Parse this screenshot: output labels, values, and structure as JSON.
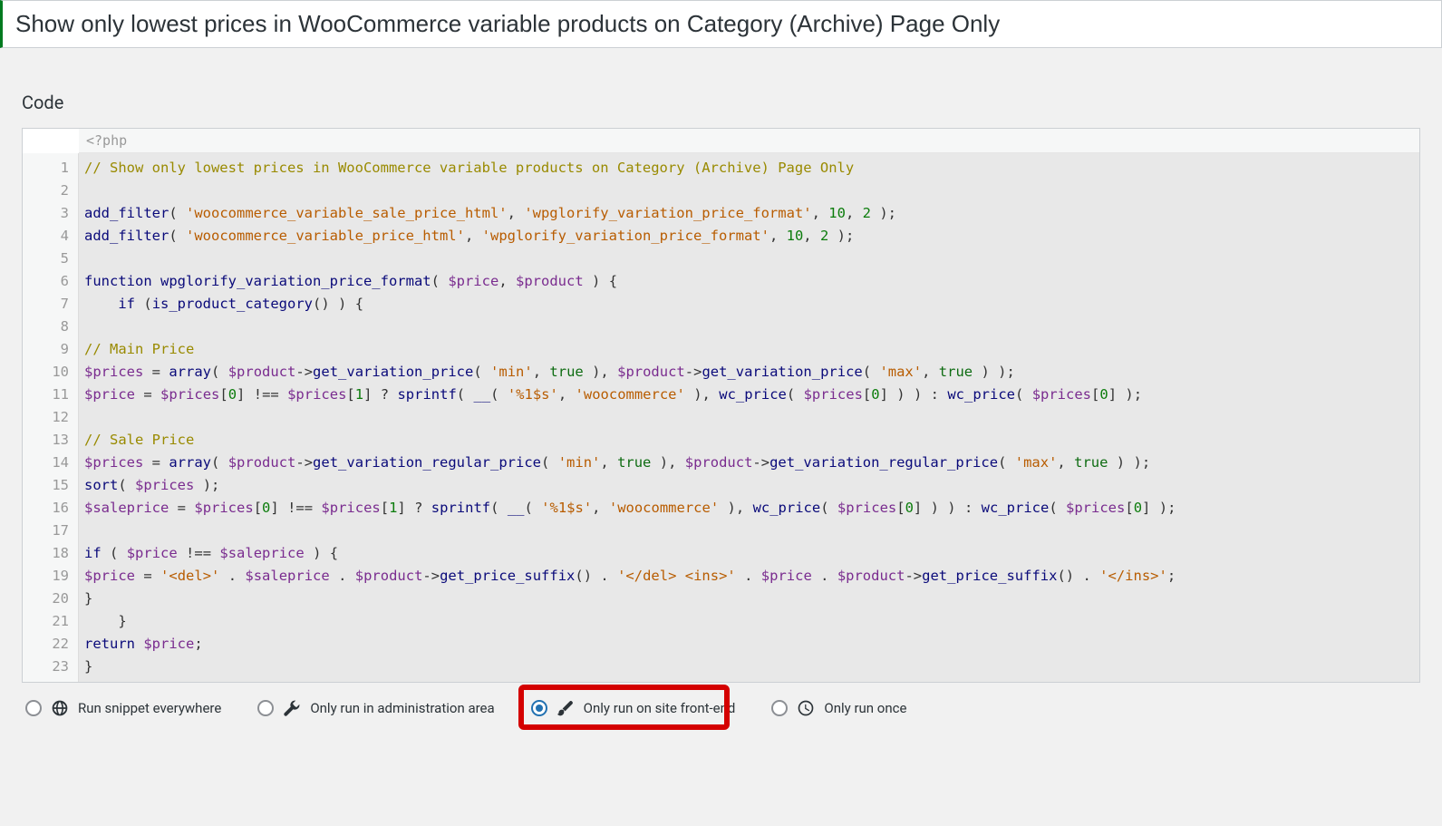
{
  "title": "Show only lowest prices in WooCommerce variable products on Category (Archive) Page Only",
  "section_heading": "Code",
  "php_opener": "<?php",
  "code": {
    "line_count": 23,
    "lines_html": [
      "<span class='c-comment'>// Show only lowest prices in WooCommerce variable products on Category (Archive) Page Only</span>",
      "",
      "<span class='c-fn'>add_filter</span><span class='c-paren'>(</span> <span class='c-str'>'woocommerce_variable_sale_price_html'</span><span class='c-plain'>,</span> <span class='c-str'>'wpglorify_variation_price_format'</span><span class='c-plain'>,</span> <span class='c-num'>10</span><span class='c-plain'>,</span> <span class='c-num'>2</span> <span class='c-paren'>)</span><span class='c-plain'>;</span>",
      "<span class='c-fn'>add_filter</span><span class='c-paren'>(</span> <span class='c-str'>'woocommerce_variable_price_html'</span><span class='c-plain'>,</span> <span class='c-str'>'wpglorify_variation_price_format'</span><span class='c-plain'>,</span> <span class='c-num'>10</span><span class='c-plain'>,</span> <span class='c-num'>2</span> <span class='c-paren'>)</span><span class='c-plain'>;</span>",
      "",
      "<span class='c-kw'>function</span> <span class='c-fn'>wpglorify_variation_price_format</span><span class='c-paren'>(</span> <span class='c-var'>$price</span><span class='c-plain'>,</span> <span class='c-var'>$product</span> <span class='c-paren'>)</span> <span class='c-paren'>{</span>",
      "    <span class='c-kw'>if</span> <span class='c-paren'>(</span><span class='c-fn'>is_product_category</span><span class='c-paren'>()</span> <span class='c-paren'>)</span> <span class='c-paren'>{</span>",
      "",
      "<span class='c-comment'>// Main Price</span>",
      "<span class='c-var'>$prices</span> <span class='c-op'>=</span> <span class='c-fn'>array</span><span class='c-paren'>(</span> <span class='c-var'>$product</span><span class='c-op'>-></span><span class='c-fn'>get_variation_price</span><span class='c-paren'>(</span> <span class='c-str'>'min'</span><span class='c-plain'>,</span> <span class='c-bool'>true</span> <span class='c-paren'>)</span><span class='c-plain'>,</span> <span class='c-var'>$product</span><span class='c-op'>-></span><span class='c-fn'>get_variation_price</span><span class='c-paren'>(</span> <span class='c-str'>'max'</span><span class='c-plain'>,</span> <span class='c-bool'>true</span> <span class='c-paren'>)</span> <span class='c-paren'>)</span><span class='c-plain'>;</span>",
      "<span class='c-var'>$price</span> <span class='c-op'>=</span> <span class='c-var'>$prices</span><span class='c-paren'>[</span><span class='c-num'>0</span><span class='c-paren'>]</span> <span class='c-op'>!==</span> <span class='c-var'>$prices</span><span class='c-paren'>[</span><span class='c-num'>1</span><span class='c-paren'>]</span> <span class='c-op'>?</span> <span class='c-fn'>sprintf</span><span class='c-paren'>(</span> <span class='c-fn'>__</span><span class='c-paren'>(</span> <span class='c-str'>'%1$s'</span><span class='c-plain'>,</span> <span class='c-str'>'woocommerce'</span> <span class='c-paren'>)</span><span class='c-plain'>,</span> <span class='c-fn'>wc_price</span><span class='c-paren'>(</span> <span class='c-var'>$prices</span><span class='c-paren'>[</span><span class='c-num'>0</span><span class='c-paren'>]</span> <span class='c-paren'>)</span> <span class='c-paren'>)</span> <span class='c-op'>:</span> <span class='c-fn'>wc_price</span><span class='c-paren'>(</span> <span class='c-var'>$prices</span><span class='c-paren'>[</span><span class='c-num'>0</span><span class='c-paren'>]</span> <span class='c-paren'>)</span><span class='c-plain'>;</span>",
      "",
      "<span class='c-comment'>// Sale Price</span>",
      "<span class='c-var'>$prices</span> <span class='c-op'>=</span> <span class='c-fn'>array</span><span class='c-paren'>(</span> <span class='c-var'>$product</span><span class='c-op'>-></span><span class='c-fn'>get_variation_regular_price</span><span class='c-paren'>(</span> <span class='c-str'>'min'</span><span class='c-plain'>,</span> <span class='c-bool'>true</span> <span class='c-paren'>)</span><span class='c-plain'>,</span> <span class='c-var'>$product</span><span class='c-op'>-></span><span class='c-fn'>get_variation_regular_price</span><span class='c-paren'>(</span> <span class='c-str'>'max'</span><span class='c-plain'>,</span> <span class='c-bool'>true</span> <span class='c-paren'>)</span> <span class='c-paren'>)</span><span class='c-plain'>;</span>",
      "<span class='c-fn'>sort</span><span class='c-paren'>(</span> <span class='c-var'>$prices</span> <span class='c-paren'>)</span><span class='c-plain'>;</span>",
      "<span class='c-var'>$saleprice</span> <span class='c-op'>=</span> <span class='c-var'>$prices</span><span class='c-paren'>[</span><span class='c-num'>0</span><span class='c-paren'>]</span> <span class='c-op'>!==</span> <span class='c-var'>$prices</span><span class='c-paren'>[</span><span class='c-num'>1</span><span class='c-paren'>]</span> <span class='c-op'>?</span> <span class='c-fn'>sprintf</span><span class='c-paren'>(</span> <span class='c-fn'>__</span><span class='c-paren'>(</span> <span class='c-str'>'%1$s'</span><span class='c-plain'>,</span> <span class='c-str'>'woocommerce'</span> <span class='c-paren'>)</span><span class='c-plain'>,</span> <span class='c-fn'>wc_price</span><span class='c-paren'>(</span> <span class='c-var'>$prices</span><span class='c-paren'>[</span><span class='c-num'>0</span><span class='c-paren'>]</span> <span class='c-paren'>)</span> <span class='c-paren'>)</span> <span class='c-op'>:</span> <span class='c-fn'>wc_price</span><span class='c-paren'>(</span> <span class='c-var'>$prices</span><span class='c-paren'>[</span><span class='c-num'>0</span><span class='c-paren'>]</span> <span class='c-paren'>)</span><span class='c-plain'>;</span>",
      "",
      "<span class='c-kw'>if</span> <span class='c-paren'>(</span> <span class='c-var'>$price</span> <span class='c-op'>!==</span> <span class='c-var'>$saleprice</span> <span class='c-paren'>)</span> <span class='c-paren'>{</span>",
      "<span class='c-var'>$price</span> <span class='c-op'>=</span> <span class='c-str'>'&lt;del&gt;'</span> <span class='c-op'>.</span> <span class='c-var'>$saleprice</span> <span class='c-op'>.</span> <span class='c-var'>$product</span><span class='c-op'>-></span><span class='c-fn'>get_price_suffix</span><span class='c-paren'>()</span> <span class='c-op'>.</span> <span class='c-str'>'&lt;/del&gt; &lt;ins&gt;'</span> <span class='c-op'>.</span> <span class='c-var'>$price</span> <span class='c-op'>.</span> <span class='c-var'>$product</span><span class='c-op'>-></span><span class='c-fn'>get_price_suffix</span><span class='c-paren'>()</span> <span class='c-op'>.</span> <span class='c-str'>'&lt;/ins&gt;'</span><span class='c-plain'>;</span>",
      "<span class='c-paren'>}</span>",
      "    <span class='c-paren'>}</span>",
      "<span class='c-kw'>return</span> <span class='c-var'>$price</span><span class='c-plain'>;</span>",
      "<span class='c-paren'>}</span>"
    ]
  },
  "scope_options": [
    {
      "id": "everywhere",
      "label": "Run snippet everywhere",
      "icon": "globe",
      "checked": false
    },
    {
      "id": "admin",
      "label": "Only run in administration area",
      "icon": "wrench",
      "checked": false
    },
    {
      "id": "frontend",
      "label": "Only run on site front-end",
      "icon": "brush",
      "checked": true,
      "highlighted": true
    },
    {
      "id": "once",
      "label": "Only run once",
      "icon": "clock",
      "checked": false
    }
  ]
}
